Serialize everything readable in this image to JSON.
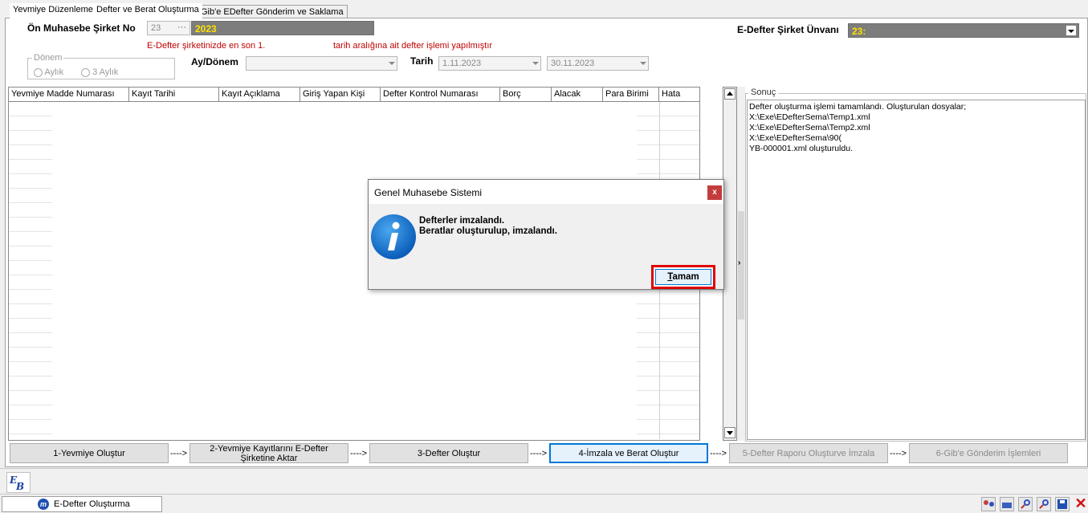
{
  "tabs": [
    {
      "label": "Yevmiye Düzenleme"
    },
    {
      "label": "Defter ve Berat Oluşturma"
    },
    {
      "label": "Gib'e EDefter Gönderim ve Saklama"
    }
  ],
  "form": {
    "company_no_label": "Ön Muhasebe Şirket No",
    "company_no_value": "23",
    "company_no_dots": "···",
    "year_value": "2023",
    "warning_part1": "E-Defter şirketinizde en son 1.",
    "warning_part2": "tarih aralığına ait defter işlemi yapılmıştır",
    "edefter_company_label": "E-Defter Şirket Ünvanı",
    "edefter_company_value": "23:",
    "period_group_label": "Dönem",
    "period_option_monthly": "Aylık",
    "period_option_quarterly": "3 Aylık",
    "month_label": "Ay/Dönem",
    "month_value": "",
    "date_label": "Tarih",
    "date_from": "1.11.2023",
    "date_to": "30.11.2023"
  },
  "grid": {
    "columns": [
      "Yevmiye Madde Numarası",
      "Kayıt Tarihi",
      "Kayıt Açıklama",
      "Giriş Yapan Kişi",
      "Defter Kontrol Numarası",
      "Borç",
      "Alacak",
      "Para Birimi",
      "Hata"
    ]
  },
  "result": {
    "label": "Sonuç",
    "lines": [
      "Defter oluşturma işlemi tamamlandı. Oluşturulan dosyalar;",
      "X:\\Exe\\EDefterSema\\Temp1.xml",
      "X:\\Exe\\EDefterSema\\Temp2.xml",
      "X:\\Exe\\EDefterSema\\90(",
      "YB-000001.xml oluşturuldu."
    ]
  },
  "steps": {
    "step1": "1-Yevmiye Oluştur",
    "step2": "2-Yevmiye Kayıtlarını E-Defter Şirketine Aktar",
    "step3": "3-Defter Oluştur",
    "step4": "4-İmzala ve Berat Oluştur",
    "step5": "5-Defter Raporu Oluşturve İmzala",
    "step6": "6-Gib'e Gönderim İşlemleri",
    "arrow": "---->"
  },
  "dialog": {
    "title": "Genel Muhasebe Sistemi",
    "close": "x",
    "line1": "Defterler imzalandı.",
    "line2": "Beratlar oluşturulup, imzalandı.",
    "ok_rest": "amam",
    "ok_underlined": "T"
  },
  "taskbar": {
    "app_label": "E-Defter Oluşturma"
  },
  "colors": {
    "accent": "#0078d7",
    "highlight_border": "#e00000",
    "dark_field": "#7d7d7d",
    "dark_field_text": "#ffe000",
    "warning_text": "#c00000"
  }
}
